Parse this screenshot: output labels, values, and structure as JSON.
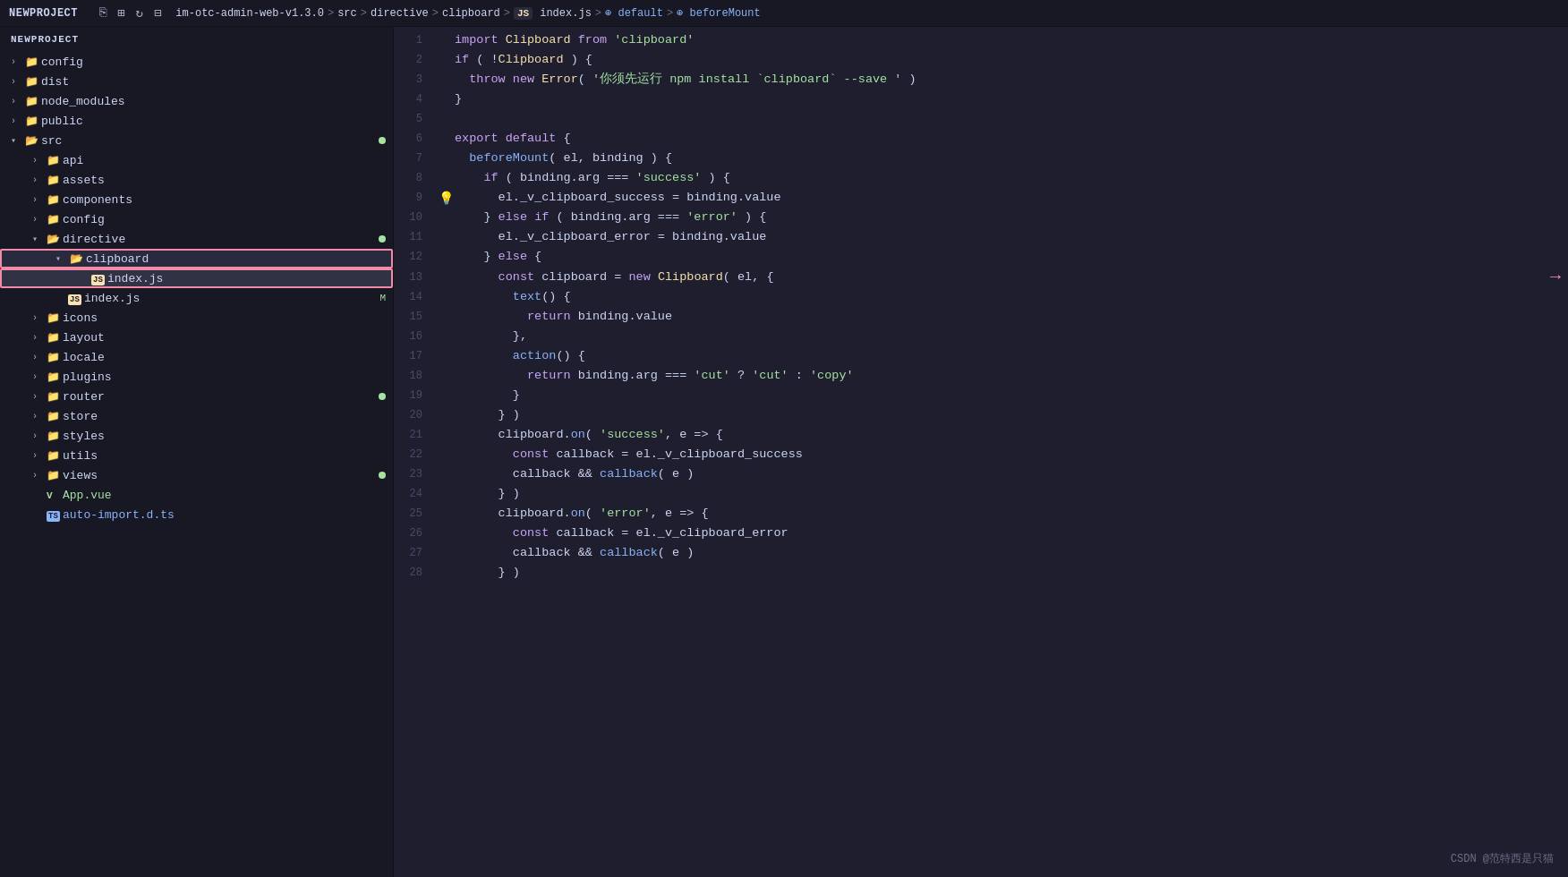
{
  "titlebar": {
    "project": "NEWPROJECT",
    "icons": [
      "new-file",
      "new-folder",
      "refresh",
      "collapse"
    ],
    "breadcrumb": {
      "parts": [
        {
          "text": "im-otc-admin-web-v1.3.0",
          "type": "text"
        },
        {
          "text": ">",
          "type": "sep"
        },
        {
          "text": "src",
          "type": "text"
        },
        {
          "text": ">",
          "type": "sep"
        },
        {
          "text": "directive",
          "type": "text"
        },
        {
          "text": ">",
          "type": "sep"
        },
        {
          "text": "clipboard",
          "type": "text"
        },
        {
          "text": ">",
          "type": "sep"
        },
        {
          "text": "JS index.js",
          "type": "js"
        },
        {
          "text": ">",
          "type": "sep"
        },
        {
          "text": "⊕ default",
          "type": "func"
        },
        {
          "text": ">",
          "type": "sep"
        },
        {
          "text": "⊕ beforeMount",
          "type": "func"
        }
      ]
    }
  },
  "sidebar": {
    "header": "NEWPROJECT",
    "items": [
      {
        "label": "config",
        "type": "folder",
        "indent": 12,
        "expanded": false
      },
      {
        "label": "dist",
        "type": "folder",
        "indent": 12,
        "expanded": false
      },
      {
        "label": "node_modules",
        "type": "folder",
        "indent": 12,
        "expanded": false
      },
      {
        "label": "public",
        "type": "folder",
        "indent": 12,
        "expanded": false
      },
      {
        "label": "src",
        "type": "folder",
        "indent": 12,
        "expanded": true,
        "badge": true
      },
      {
        "label": "api",
        "type": "folder",
        "indent": 36,
        "expanded": false
      },
      {
        "label": "assets",
        "type": "folder",
        "indent": 36,
        "expanded": false
      },
      {
        "label": "components",
        "type": "folder",
        "indent": 36,
        "expanded": false
      },
      {
        "label": "config",
        "type": "folder",
        "indent": 36,
        "expanded": false
      },
      {
        "label": "directive",
        "type": "folder",
        "indent": 36,
        "expanded": true,
        "badge": true
      },
      {
        "label": "clipboard",
        "type": "folder",
        "indent": 60,
        "expanded": true,
        "highlighted": true
      },
      {
        "label": "index.js",
        "type": "js",
        "indent": 84,
        "active": true
      },
      {
        "label": "index.js",
        "type": "js",
        "indent": 60,
        "modified": "M"
      },
      {
        "label": "icons",
        "type": "folder",
        "indent": 36,
        "expanded": false
      },
      {
        "label": "layout",
        "type": "folder",
        "indent": 36,
        "expanded": false
      },
      {
        "label": "locale",
        "type": "folder",
        "indent": 36,
        "expanded": false
      },
      {
        "label": "plugins",
        "type": "folder",
        "indent": 36,
        "expanded": false
      },
      {
        "label": "router",
        "type": "folder",
        "indent": 36,
        "expanded": false,
        "badge": true
      },
      {
        "label": "store",
        "type": "folder",
        "indent": 36,
        "expanded": false
      },
      {
        "label": "styles",
        "type": "folder",
        "indent": 36,
        "expanded": false
      },
      {
        "label": "utils",
        "type": "folder",
        "indent": 36,
        "expanded": false
      },
      {
        "label": "views",
        "type": "folder",
        "indent": 36,
        "expanded": false,
        "badge": true
      },
      {
        "label": "App.vue",
        "type": "vue",
        "indent": 36
      },
      {
        "label": "auto-import.d.ts",
        "type": "ts",
        "indent": 36
      }
    ]
  },
  "editor": {
    "lines": [
      {
        "num": 1,
        "tokens": [
          {
            "t": "kw",
            "v": "import"
          },
          {
            "t": "plain",
            "v": " "
          },
          {
            "t": "cls",
            "v": "Clipboard"
          },
          {
            "t": "plain",
            "v": " "
          },
          {
            "t": "kw",
            "v": "from"
          },
          {
            "t": "plain",
            "v": " "
          },
          {
            "t": "str",
            "v": "'clipboard'"
          }
        ]
      },
      {
        "num": 2,
        "tokens": [
          {
            "t": "kw",
            "v": "if"
          },
          {
            "t": "plain",
            "v": " ( !"
          },
          {
            "t": "cls",
            "v": "Clipboard"
          },
          {
            "t": "plain",
            "v": " ) {"
          }
        ]
      },
      {
        "num": 3,
        "tokens": [
          {
            "t": "plain",
            "v": "  "
          },
          {
            "t": "kw",
            "v": "throw"
          },
          {
            "t": "plain",
            "v": " "
          },
          {
            "t": "kw",
            "v": "new"
          },
          {
            "t": "plain",
            "v": " "
          },
          {
            "t": "cls",
            "v": "Error"
          },
          {
            "t": "plain",
            "v": "( "
          },
          {
            "t": "str",
            "v": "'你须先运行 npm install `clipboard` --save '"
          },
          {
            "t": "plain",
            "v": " )"
          }
        ]
      },
      {
        "num": 4,
        "tokens": [
          {
            "t": "plain",
            "v": "}"
          }
        ]
      },
      {
        "num": 5,
        "tokens": []
      },
      {
        "num": 6,
        "tokens": [
          {
            "t": "kw",
            "v": "export"
          },
          {
            "t": "plain",
            "v": " "
          },
          {
            "t": "kw",
            "v": "default"
          },
          {
            "t": "plain",
            "v": " {"
          }
        ]
      },
      {
        "num": 7,
        "tokens": [
          {
            "t": "plain",
            "v": "  "
          },
          {
            "t": "fn",
            "v": "beforeMount"
          },
          {
            "t": "plain",
            "v": "( el, binding ) {"
          }
        ]
      },
      {
        "num": 8,
        "tokens": [
          {
            "t": "plain",
            "v": "    "
          },
          {
            "t": "kw",
            "v": "if"
          },
          {
            "t": "plain",
            "v": " ( binding.arg === "
          },
          {
            "t": "str",
            "v": "'success'"
          },
          {
            "t": "plain",
            "v": " ) {"
          }
        ]
      },
      {
        "num": 9,
        "tokens": [
          {
            "t": "plain",
            "v": "      el._v_clipboard_success = binding.value"
          }
        ],
        "bulb": true
      },
      {
        "num": 10,
        "tokens": [
          {
            "t": "plain",
            "v": "    } "
          },
          {
            "t": "kw",
            "v": "else"
          },
          {
            "t": "plain",
            "v": " "
          },
          {
            "t": "kw",
            "v": "if"
          },
          {
            "t": "plain",
            "v": " ( binding.arg === "
          },
          {
            "t": "str",
            "v": "'error'"
          },
          {
            "t": "plain",
            "v": " ) {"
          }
        ]
      },
      {
        "num": 11,
        "tokens": [
          {
            "t": "plain",
            "v": "      el._v_clipboard_error = binding.value"
          }
        ]
      },
      {
        "num": 12,
        "tokens": [
          {
            "t": "plain",
            "v": "    } "
          },
          {
            "t": "kw",
            "v": "else"
          },
          {
            "t": "plain",
            "v": " {"
          }
        ]
      },
      {
        "num": 13,
        "tokens": [
          {
            "t": "plain",
            "v": "      "
          },
          {
            "t": "kw",
            "v": "const"
          },
          {
            "t": "plain",
            "v": " clipboard = "
          },
          {
            "t": "kw",
            "v": "new"
          },
          {
            "t": "plain",
            "v": " "
          },
          {
            "t": "cls",
            "v": "Clipboard"
          },
          {
            "t": "plain",
            "v": "( el, {"
          }
        ],
        "arrow": true
      },
      {
        "num": 14,
        "tokens": [
          {
            "t": "plain",
            "v": "        "
          },
          {
            "t": "fn",
            "v": "text"
          },
          {
            "t": "plain",
            "v": "() {"
          }
        ]
      },
      {
        "num": 15,
        "tokens": [
          {
            "t": "plain",
            "v": "          "
          },
          {
            "t": "kw",
            "v": "return"
          },
          {
            "t": "plain",
            "v": " binding.value"
          }
        ]
      },
      {
        "num": 16,
        "tokens": [
          {
            "t": "plain",
            "v": "        },"
          }
        ]
      },
      {
        "num": 17,
        "tokens": [
          {
            "t": "plain",
            "v": "        "
          },
          {
            "t": "fn",
            "v": "action"
          },
          {
            "t": "plain",
            "v": "() {"
          }
        ]
      },
      {
        "num": 18,
        "tokens": [
          {
            "t": "plain",
            "v": "          "
          },
          {
            "t": "kw",
            "v": "return"
          },
          {
            "t": "plain",
            "v": " binding.arg === "
          },
          {
            "t": "str",
            "v": "'cut'"
          },
          {
            "t": "plain",
            "v": " ? "
          },
          {
            "t": "str",
            "v": "'cut'"
          },
          {
            "t": "plain",
            "v": " : "
          },
          {
            "t": "str",
            "v": "'copy'"
          }
        ]
      },
      {
        "num": 19,
        "tokens": [
          {
            "t": "plain",
            "v": "        }"
          }
        ]
      },
      {
        "num": 20,
        "tokens": [
          {
            "t": "plain",
            "v": "      } )"
          }
        ]
      },
      {
        "num": 21,
        "tokens": [
          {
            "t": "plain",
            "v": "      clipboard."
          },
          {
            "t": "fn",
            "v": "on"
          },
          {
            "t": "plain",
            "v": "( "
          },
          {
            "t": "str",
            "v": "'success'"
          },
          {
            "t": "plain",
            "v": ", e => {"
          }
        ]
      },
      {
        "num": 22,
        "tokens": [
          {
            "t": "plain",
            "v": "        "
          },
          {
            "t": "kw",
            "v": "const"
          },
          {
            "t": "plain",
            "v": " callback = el._v_clipboard_success"
          }
        ]
      },
      {
        "num": 23,
        "tokens": [
          {
            "t": "plain",
            "v": "        callback && "
          },
          {
            "t": "fn",
            "v": "callback"
          },
          {
            "t": "plain",
            "v": "( e )"
          }
        ]
      },
      {
        "num": 24,
        "tokens": [
          {
            "t": "plain",
            "v": "      } )"
          }
        ]
      },
      {
        "num": 25,
        "tokens": [
          {
            "t": "plain",
            "v": "      clipboard."
          },
          {
            "t": "fn",
            "v": "on"
          },
          {
            "t": "plain",
            "v": "( "
          },
          {
            "t": "str",
            "v": "'error'"
          },
          {
            "t": "plain",
            "v": ", e => {"
          }
        ]
      },
      {
        "num": 26,
        "tokens": [
          {
            "t": "plain",
            "v": "        "
          },
          {
            "t": "kw",
            "v": "const"
          },
          {
            "t": "plain",
            "v": " callback = el._v_clipboard_error"
          }
        ]
      },
      {
        "num": 27,
        "tokens": [
          {
            "t": "plain",
            "v": "        callback && "
          },
          {
            "t": "fn",
            "v": "callback"
          },
          {
            "t": "plain",
            "v": "( e )"
          }
        ]
      },
      {
        "num": 28,
        "tokens": [
          {
            "t": "plain",
            "v": "      } )"
          }
        ]
      }
    ]
  },
  "watermark": "CSDN @范特西是只猫",
  "icons": {
    "new_file": "□+",
    "new_folder": "⊞",
    "refresh": "↻",
    "collapse": "⊟",
    "chevron_right": "›",
    "chevron_down": "⌄",
    "folder": "📁",
    "js_badge": "JS",
    "vue_badge": "V",
    "ts_badge": "TS"
  }
}
